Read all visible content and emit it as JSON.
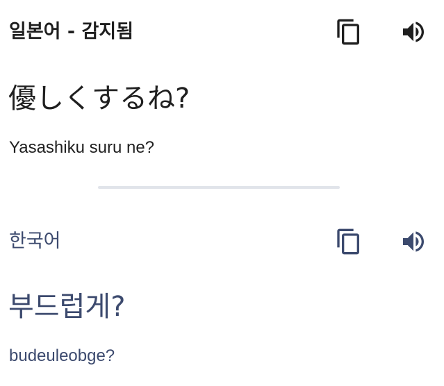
{
  "source": {
    "language_label": "일본어 - 감지됨",
    "text": "優しくするね?",
    "transliteration": "Yasashiku suru ne?",
    "copy_icon": "copy-icon",
    "speaker_icon": "speaker-icon"
  },
  "target": {
    "language_label": "한국어",
    "text": "부드럽게?",
    "transliteration": "budeuleobge?",
    "copy_icon": "copy-icon",
    "speaker_icon": "speaker-icon"
  },
  "colors": {
    "source_text": "#1f1f1f",
    "target_text": "#3c4a6e",
    "divider": "#e1e4ea"
  }
}
